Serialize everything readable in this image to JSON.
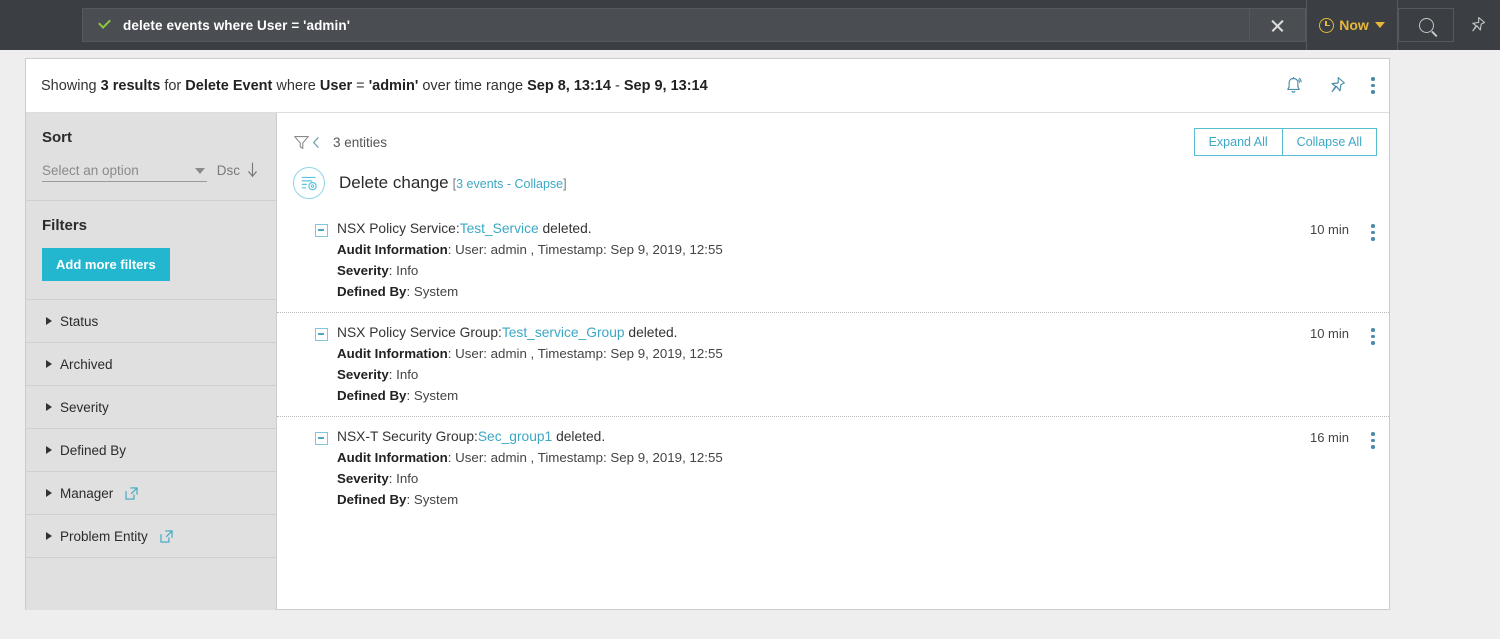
{
  "topbar": {
    "query_value": "delete events where User = 'admin'",
    "check_icon": "check-icon",
    "close_icon": "close-icon",
    "time_range_label": "Now",
    "clock_icon": "clock-icon",
    "caret_icon": "chevron-down-icon",
    "search_icon": "search-icon",
    "pin_icon": "pin-icon",
    "bg_color": "#3b3e42",
    "accent_color": "#e8b73a"
  },
  "results_header": {
    "prefix": "Showing ",
    "count": "3 results",
    "mid1": " for ",
    "event_type": "Delete Event",
    "mid2": " where ",
    "field": "User",
    "mid3": " = ",
    "value": "'admin'",
    "mid4": " over time range ",
    "range_start": "Sep 8, 13:14",
    "range_sep": " - ",
    "range_end": "Sep 9, 13:14",
    "bell_icon": "bell-icon",
    "pin_icon": "pin-icon",
    "more_icon": "kebab-menu-icon"
  },
  "sidebar": {
    "sort_title": "Sort",
    "sort_placeholder": "Select an option",
    "sort_direction": "Dsc",
    "sort_direction_icon": "arrow-down-icon",
    "filters_title": "Filters",
    "add_filters_label": "Add more filters",
    "add_filters_color": "#23b6cf",
    "filters": [
      {
        "label": "Status",
        "external": false
      },
      {
        "label": "Archived",
        "external": false
      },
      {
        "label": "Severity",
        "external": false
      },
      {
        "label": "Defined By",
        "external": false
      },
      {
        "label": "Manager",
        "external": true
      },
      {
        "label": "Problem Entity",
        "external": true
      }
    ]
  },
  "content": {
    "filter_icon": "funnel-filter-icon",
    "entities_count": "3 entities",
    "expand_all_label": "Expand All",
    "collapse_all_label": "Collapse All",
    "accent_color": "#3ba8c4",
    "group": {
      "icon": "change-event-icon",
      "title": "Delete change",
      "meta_open": "[",
      "meta_events": "3 events - ",
      "meta_action": "Collapse",
      "meta_close": "]"
    },
    "events": [
      {
        "prefix": "NSX Policy Service:",
        "link": "Test_Service",
        "suffix": " deleted.",
        "audit_label": "Audit Information",
        "audit_value": ": User: admin , Timestamp: Sep 9, 2019, 12:55",
        "severity_label": "Severity",
        "severity_value": ": Info",
        "defined_label": "Defined By",
        "defined_value": ": System",
        "time": "10 min",
        "toggle_icon": "collapse-minus-icon",
        "more_icon": "kebab-menu-icon"
      },
      {
        "prefix": "NSX Policy Service Group:",
        "link": "Test_service_Group",
        "suffix": " deleted.",
        "audit_label": "Audit Information",
        "audit_value": ": User: admin , Timestamp: Sep 9, 2019, 12:55",
        "severity_label": "Severity",
        "severity_value": ": Info",
        "defined_label": "Defined By",
        "defined_value": ": System",
        "time": "10 min",
        "toggle_icon": "collapse-minus-icon",
        "more_icon": "kebab-menu-icon"
      },
      {
        "prefix": "NSX-T Security Group:",
        "link": "Sec_group1",
        "suffix": " deleted.",
        "audit_label": "Audit Information",
        "audit_value": ": User: admin , Timestamp: Sep 9, 2019, 12:55",
        "severity_label": "Severity",
        "severity_value": ": Info",
        "defined_label": "Defined By",
        "defined_value": ": System",
        "time": "16 min",
        "toggle_icon": "collapse-minus-icon",
        "more_icon": "kebab-menu-icon"
      }
    ]
  }
}
